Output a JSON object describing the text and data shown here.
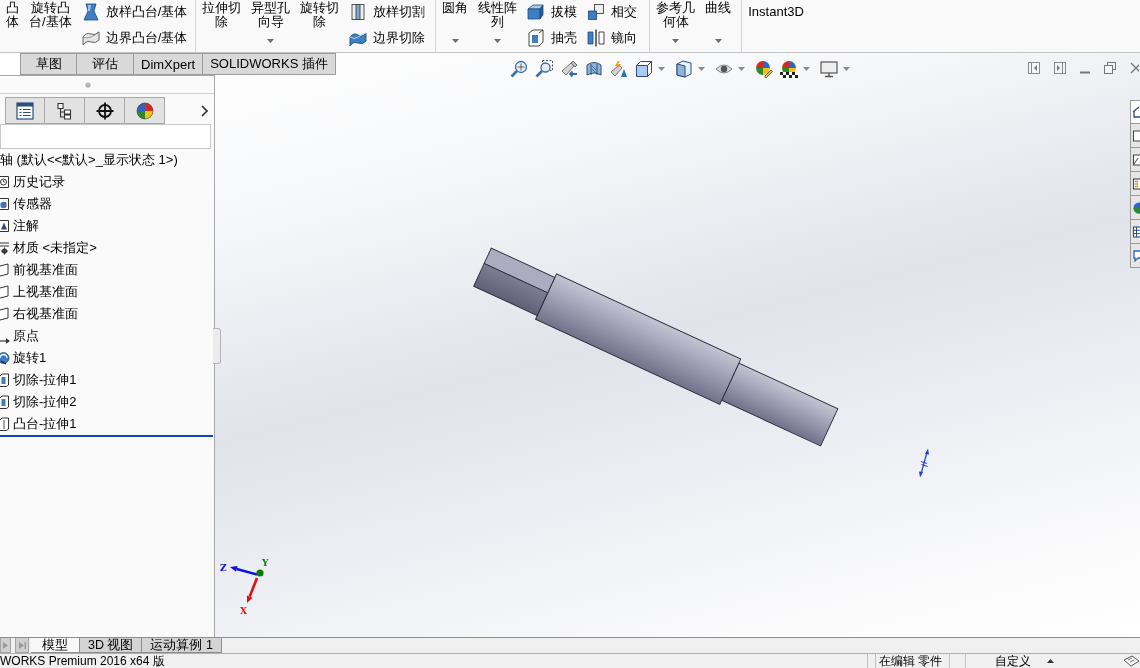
{
  "ribbon": {
    "groups": [
      {
        "columns": [
          {
            "kind": "large",
            "lines": [
              "凸",
              "体"
            ],
            "dropdown": false
          },
          {
            "kind": "large",
            "lines": [
              "旋转凸",
              "台/基体"
            ],
            "dropdown": false
          },
          {
            "kind": "stack",
            "buttons": [
              {
                "label": "放样凸台/基体"
              },
              {
                "label": "边界凸台/基体"
              }
            ]
          }
        ]
      },
      {
        "columns": [
          {
            "kind": "large",
            "lines": [
              "拉伸切",
              "除"
            ],
            "dropdown": false
          },
          {
            "kind": "large",
            "lines": [
              "异型孔",
              "向导"
            ],
            "dropdown": true
          },
          {
            "kind": "large",
            "lines": [
              "旋转切",
              "除"
            ],
            "dropdown": false
          },
          {
            "kind": "stack",
            "buttons": [
              {
                "label": "放样切割"
              },
              {
                "label": "边界切除"
              }
            ]
          }
        ]
      },
      {
        "columns": [
          {
            "kind": "large",
            "lines": [
              "圆角"
            ],
            "dropdown": true
          },
          {
            "kind": "large",
            "lines": [
              "线性阵",
              "列"
            ],
            "dropdown": true
          },
          {
            "kind": "stack",
            "buttons": [
              {
                "label": "拔模"
              },
              {
                "label": "抽壳"
              }
            ]
          },
          {
            "kind": "stack",
            "buttons": [
              {
                "label": "相交"
              },
              {
                "label": "镜向"
              }
            ]
          }
        ]
      },
      {
        "columns": [
          {
            "kind": "large",
            "lines": [
              "参考几",
              "何体"
            ],
            "dropdown": true
          },
          {
            "kind": "large",
            "lines": [
              "曲线"
            ],
            "dropdown": true
          }
        ]
      },
      {
        "columns": [
          {
            "kind": "large",
            "lines": [
              "Instant3D"
            ],
            "dropdown": false
          }
        ]
      }
    ]
  },
  "command_tabs": [
    {
      "label": "草图",
      "selected": false
    },
    {
      "label": "评估",
      "selected": false
    },
    {
      "label": "DimXpert",
      "selected": false
    },
    {
      "label": "SOLIDWORKS 插件",
      "selected": false
    }
  ],
  "feature_tree": {
    "root": {
      "label": "轴 (默认<<默认>_显示状态 1>)",
      "children": [
        {
          "label": "历史记录",
          "kind": "history"
        },
        {
          "label": "传感器",
          "kind": "sensors"
        },
        {
          "label": "注解",
          "kind": "annotations"
        },
        {
          "label": "材质 <未指定>",
          "kind": "material"
        },
        {
          "label": "前视基准面",
          "kind": "plane"
        },
        {
          "label": "上视基准面",
          "kind": "plane"
        },
        {
          "label": "右视基准面",
          "kind": "plane"
        },
        {
          "label": "原点",
          "kind": "origin"
        },
        {
          "label": "旋转1",
          "kind": "revolve"
        },
        {
          "label": "切除-拉伸1",
          "kind": "cut"
        },
        {
          "label": "切除-拉伸2",
          "kind": "cut"
        },
        {
          "label": "凸台-拉伸1",
          "kind": "boss"
        }
      ]
    }
  },
  "task_pane": {
    "tabs": [
      {
        "selected": true
      },
      {
        "selected": false
      },
      {
        "selected": false
      },
      {
        "selected": false
      },
      {
        "selected": false
      },
      {
        "selected": false
      },
      {
        "selected": false
      }
    ]
  },
  "triad": {
    "axes": [
      {
        "label": "Z",
        "color": "#1010e0"
      },
      {
        "label": "Y",
        "color": "#0a7a0a"
      },
      {
        "label": "X",
        "color": "#e01010"
      }
    ]
  },
  "document_tabs": [
    {
      "label": "模型",
      "selected": true
    },
    {
      "label": "3D 视图",
      "selected": false
    },
    {
      "label": "运动算例 1",
      "selected": false
    }
  ],
  "status_bar": {
    "product": "WORKS Premium 2016 x64 版",
    "mode": "在编辑 零件",
    "units": "自定义"
  }
}
